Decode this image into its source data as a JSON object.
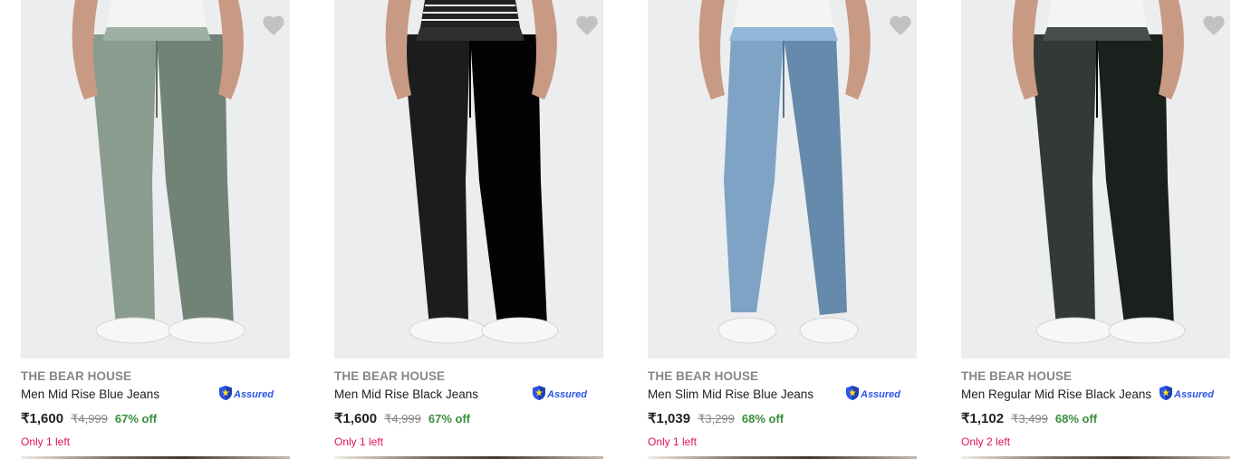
{
  "products": [
    {
      "brand": "THE BEAR HOUSE",
      "title": "Men Mid Rise Blue Jeans",
      "assured": true,
      "price": "₹1,600",
      "mrp": "₹4,999",
      "discount": "67% off",
      "stock": "Only 1 left",
      "jeans_color": "#8a9b8f",
      "top_color": "#f4f4f4"
    },
    {
      "brand": "THE BEAR HOUSE",
      "title": "Men Mid Rise Black Jeans",
      "assured": true,
      "price": "₹1,600",
      "mrp": "₹4,999",
      "discount": "67% off",
      "stock": "Only 1 left",
      "jeans_color": "#1c1c1e",
      "top_color": "#222222"
    },
    {
      "brand": "THE BEAR HOUSE",
      "title": "Men Slim Mid Rise Blue Jeans",
      "assured": true,
      "price": "₹1,039",
      "mrp": "₹3,299",
      "discount": "68% off",
      "stock": "Only 1 left",
      "jeans_color": "#7ea3c4",
      "top_color": "#f4f4f4"
    },
    {
      "brand": "THE BEAR HOUSE",
      "title": "Men Regular Mid Rise Black Jeans",
      "assured": true,
      "price": "₹1,102",
      "mrp": "₹3,499",
      "discount": "68% off",
      "stock": "Only 2 left",
      "jeans_color": "#333a36",
      "top_color": "#f4f4f4"
    }
  ],
  "assured_label": "Assured",
  "colors": {
    "brand_text": "#878787",
    "discount": "#388e3c",
    "stock": "#e0115f",
    "assured": "#2a55e5",
    "wishlist_heart": "#c2c2c2"
  },
  "icons": {
    "wishlist": "heart-icon",
    "assured": "assured-badge-icon"
  }
}
